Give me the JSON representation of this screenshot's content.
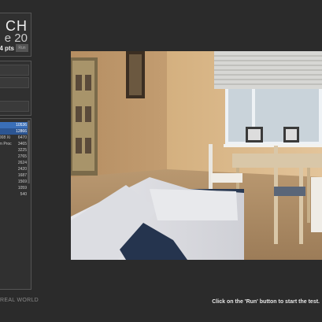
{
  "app": {
    "title_fragment": "CH",
    "subtitle_fragment": "e 20",
    "score": "4 pts",
    "run_label": "Run",
    "brand": "REAL WORLD"
  },
  "options": [
    "",
    "",
    "",
    ""
  ],
  "results": [
    {
      "label": "",
      "value": "10536",
      "state": "selected"
    },
    {
      "label": "",
      "value": "12866",
      "state": "selected2"
    },
    {
      "label": "2008 Xi",
      "value": "6470",
      "state": "normal"
    },
    {
      "label": "um Proc",
      "value": "3465",
      "state": "normal"
    },
    {
      "label": "",
      "value": "3225",
      "state": "normal"
    },
    {
      "label": "",
      "value": "2765",
      "state": "normal"
    },
    {
      "label": "",
      "value": "2624",
      "state": "normal"
    },
    {
      "label": "",
      "value": "2420",
      "state": "normal"
    },
    {
      "label": "",
      "value": "1687",
      "state": "normal"
    },
    {
      "label": "",
      "value": "1569",
      "state": "normal"
    },
    {
      "label": "",
      "value": "1059",
      "state": "normal"
    },
    {
      "label": "",
      "value": "540",
      "state": "normal"
    }
  ],
  "status": "Click on the 'Run' button to start the test.",
  "colors": {
    "background": "#2b2b2b",
    "selected_row": "#3a6fb8",
    "selected_row_alt": "#2c5592"
  }
}
